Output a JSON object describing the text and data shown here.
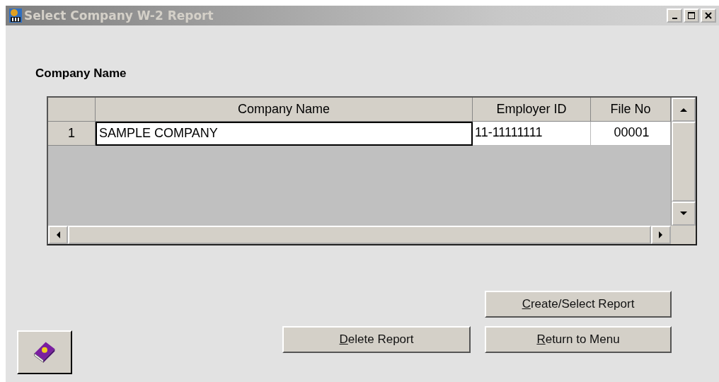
{
  "window": {
    "title": "Select Company W-2 Report",
    "active": false
  },
  "section_label": "Company Name",
  "table": {
    "columns": [
      "Company Name",
      "Employer ID",
      "File No"
    ],
    "rows": [
      {
        "number": "1",
        "cells": [
          {
            "text": "SAMPLE COMPANY",
            "focused": true
          },
          {
            "text": "11-11111111",
            "focused": false
          },
          {
            "text": "00001",
            "focused": false
          }
        ]
      }
    ]
  },
  "buttons": [
    {
      "label": "Create/Select Report",
      "underline_first": true
    },
    {
      "label": "Delete Report",
      "underline_first": true
    },
    {
      "label": "Return to Menu",
      "underline_first": true
    }
  ]
}
